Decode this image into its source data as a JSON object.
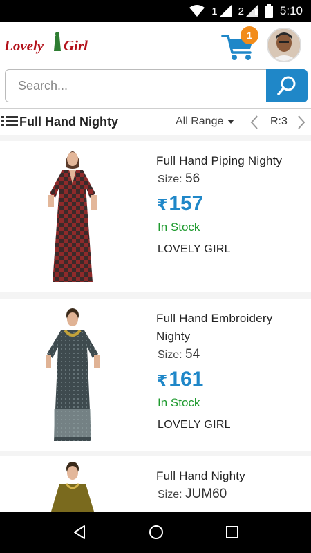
{
  "status": {
    "time": "5:10",
    "sim1": "1",
    "sim1_tag": "R",
    "sim2": "2",
    "sim2_tag": "R"
  },
  "header": {
    "logo_text": "Lovely Girl",
    "cart_count": "1"
  },
  "search": {
    "placeholder": "Search..."
  },
  "filter": {
    "category": "Full Hand Nighty",
    "range_label": "All Range",
    "page": "R:3"
  },
  "products": [
    {
      "name": "Full Hand Piping Nighty",
      "size_label": "Size:",
      "size": "56",
      "currency": "₹",
      "price": "157",
      "stock": "In Stock",
      "brand": "LOVELY GIRL"
    },
    {
      "name": "Full Hand Embroidery Nighty",
      "size_label": "Size:",
      "size": "54",
      "currency": "₹",
      "price": "161",
      "stock": "In Stock",
      "brand": "LOVELY GIRL"
    },
    {
      "name": "Full Hand Nighty",
      "size_label": "Size:",
      "size": "JUM60"
    }
  ],
  "colors": {
    "accent": "#1f87c8",
    "badge": "#f28c1b",
    "stock": "#1e9a2e",
    "logo_red": "#b3121b",
    "logo_green": "#2e7d32"
  },
  "icons": [
    "wifi-icon",
    "signal-icon",
    "battery-icon",
    "cart-icon",
    "search-icon",
    "list-icon",
    "dropdown-caret-icon",
    "chevron-left-icon",
    "chevron-right-icon",
    "back-icon",
    "home-icon",
    "recents-icon"
  ]
}
